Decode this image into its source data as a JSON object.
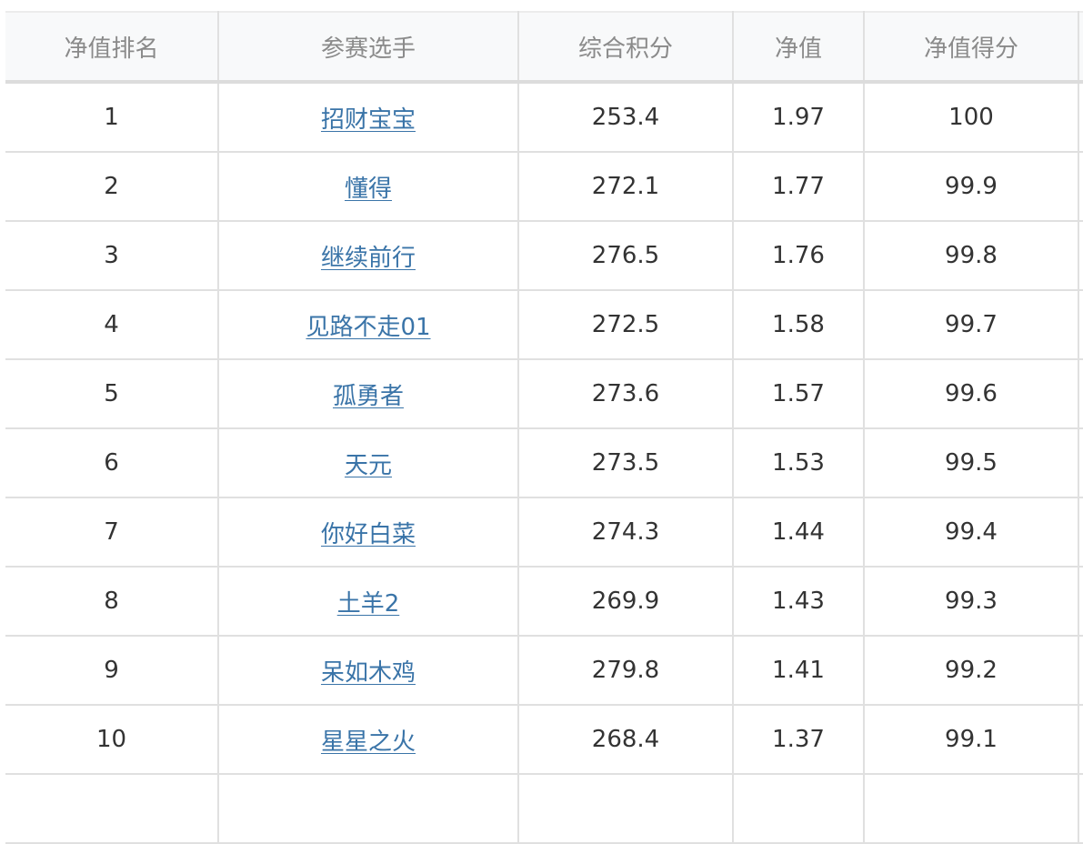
{
  "table": {
    "headers": [
      "净值排名",
      "参赛选手",
      "综合积分",
      "净值",
      "净值得分"
    ],
    "rows": [
      {
        "rank": "1",
        "player": "招财宝宝",
        "score": "253.4",
        "nav": "1.97",
        "nav_score": "100"
      },
      {
        "rank": "2",
        "player": "懂得",
        "score": "272.1",
        "nav": "1.77",
        "nav_score": "99.9"
      },
      {
        "rank": "3",
        "player": "继续前行",
        "score": "276.5",
        "nav": "1.76",
        "nav_score": "99.8"
      },
      {
        "rank": "4",
        "player": "见路不走01",
        "score": "272.5",
        "nav": "1.58",
        "nav_score": "99.7"
      },
      {
        "rank": "5",
        "player": "孤勇者",
        "score": "273.6",
        "nav": "1.57",
        "nav_score": "99.6"
      },
      {
        "rank": "6",
        "player": "天元",
        "score": "273.5",
        "nav": "1.53",
        "nav_score": "99.5"
      },
      {
        "rank": "7",
        "player": "你好白菜",
        "score": "274.3",
        "nav": "1.44",
        "nav_score": "99.4"
      },
      {
        "rank": "8",
        "player": "土羊2",
        "score": "269.9",
        "nav": "1.43",
        "nav_score": "99.3"
      },
      {
        "rank": "9",
        "player": "呆如木鸡",
        "score": "279.8",
        "nav": "1.41",
        "nav_score": "99.2"
      },
      {
        "rank": "10",
        "player": "星星之火",
        "score": "268.4",
        "nav": "1.37",
        "nav_score": "99.1"
      }
    ]
  },
  "colors": {
    "link": "#3a74a8",
    "header_bg": "#f8f9fa",
    "header_text": "#8a8a8a",
    "border": "#e0e0e0"
  }
}
